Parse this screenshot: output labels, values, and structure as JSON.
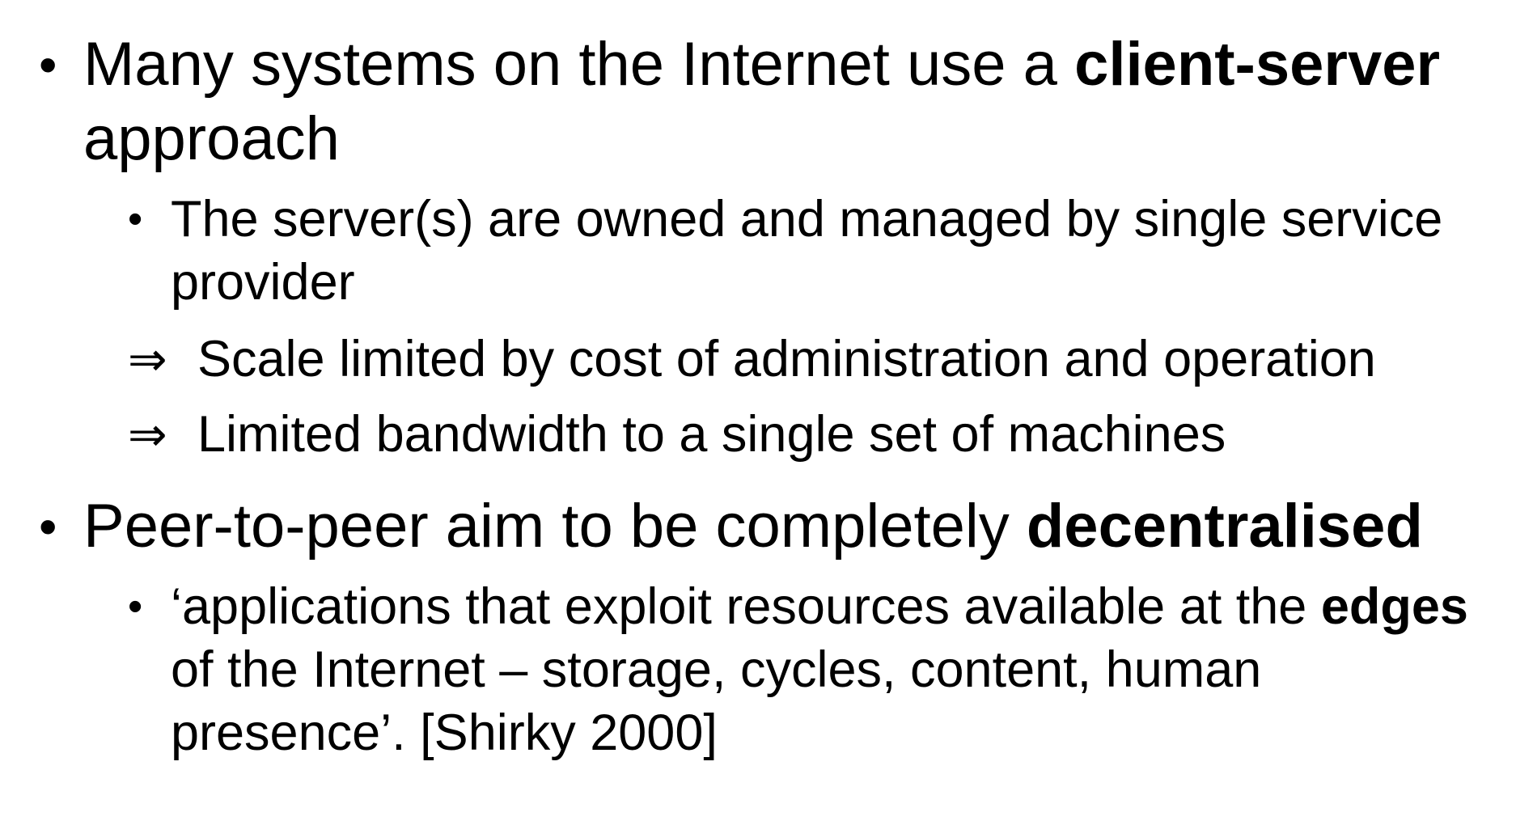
{
  "slide": {
    "bullets": [
      {
        "marker": "•",
        "text_before": "Many systems on the Internet use a ",
        "bold": "client-server",
        "text_after": " approach",
        "sub": {
          "marker": "•",
          "text": "The server(s) are owned and managed by single service provider"
        },
        "implications": [
          {
            "marker": "⇒",
            "text": "Scale limited by cost of administration and operation"
          },
          {
            "marker": "⇒",
            "text": "Limited bandwidth to a single set of machines"
          }
        ]
      },
      {
        "marker": "•",
        "text_before": "Peer-to-peer aim to be completely ",
        "bold": "decentralised",
        "sub": {
          "marker": "•",
          "text_before": "‘applications that exploit resources available at the ",
          "bold": "edges",
          "text_after": " of the Internet – storage, cycles, content, human presence’. [Shirky 2000]"
        }
      }
    ]
  }
}
